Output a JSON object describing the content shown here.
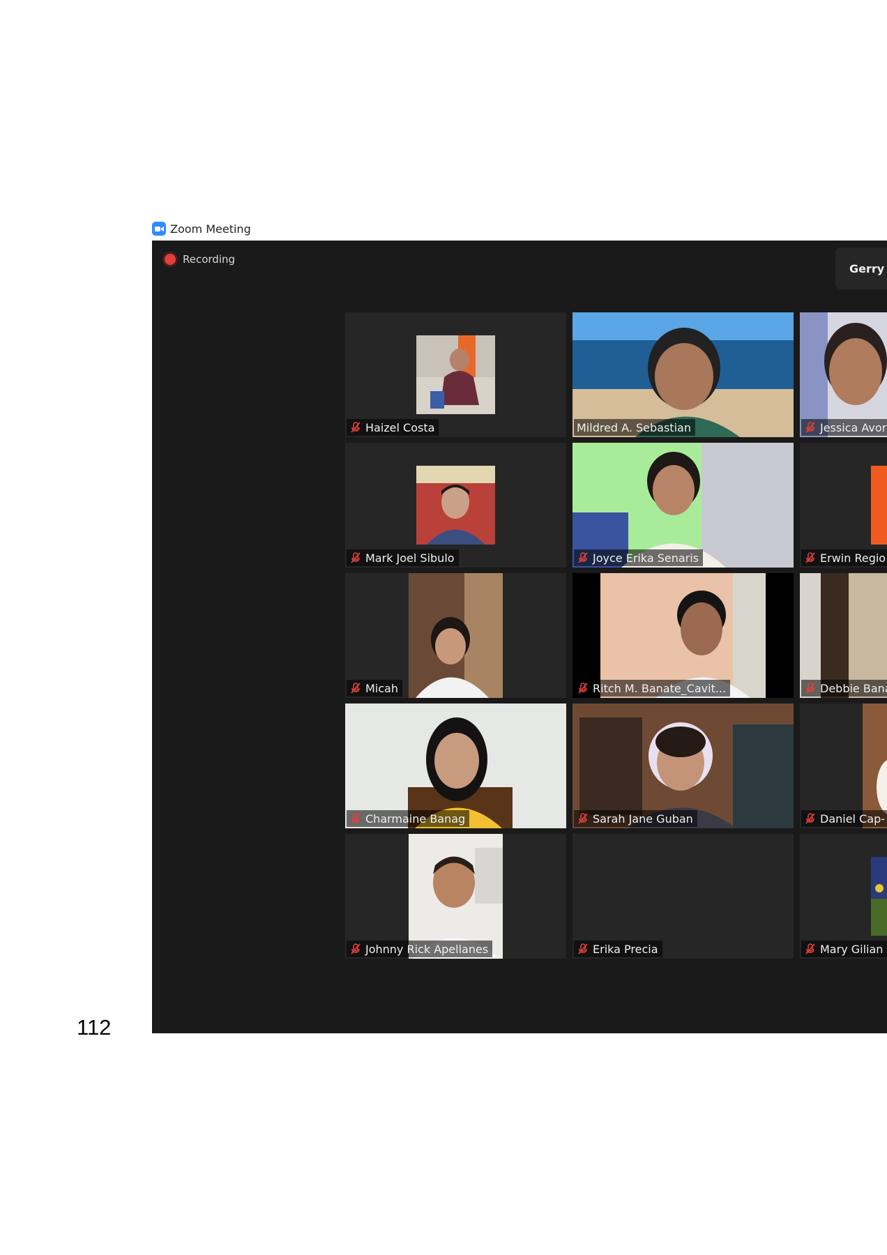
{
  "window": {
    "title": "Zoom Meeting",
    "app_icon": "zoom-camera-icon"
  },
  "meeting": {
    "recording_label": "Recording",
    "speaker_label": "Gerry I",
    "participants": [
      {
        "name": "Haizel Costa",
        "muted": true,
        "video": "profile-photo"
      },
      {
        "name": "Mildred A. Sebastian",
        "muted": false,
        "video": "camera"
      },
      {
        "name": "Jessica Avor",
        "muted": true,
        "video": "camera"
      },
      {
        "name": "Mark Joel Sibulo",
        "muted": true,
        "video": "profile-photo"
      },
      {
        "name": "Joyce Erika Senaris",
        "muted": true,
        "video": "camera"
      },
      {
        "name": "Erwin Regio",
        "muted": true,
        "video": "profile-photo"
      },
      {
        "name": "Micah",
        "muted": true,
        "video": "camera"
      },
      {
        "name": "Ritch M. Banate_Cavit...",
        "muted": true,
        "video": "camera"
      },
      {
        "name": "Debbie Bana",
        "muted": true,
        "video": "camera"
      },
      {
        "name": "Charmaine Banag",
        "muted": true,
        "video": "camera"
      },
      {
        "name": "Sarah Jane Guban",
        "muted": true,
        "video": "camera"
      },
      {
        "name": "Daniel Cap-",
        "muted": true,
        "video": "camera"
      },
      {
        "name": "Johnny Rick Apellanes",
        "muted": true,
        "video": "camera"
      },
      {
        "name": "Erika Precia",
        "muted": true,
        "video": "none"
      },
      {
        "name": "Mary Gilian",
        "muted": true,
        "video": "profile-photo"
      }
    ]
  },
  "page": {
    "number": "112"
  },
  "colors": {
    "meeting_bg": "#1a1a1a",
    "tile_bg": "#262626",
    "mute_icon": "#e0403a",
    "zoom_blue": "#2d8cff"
  }
}
